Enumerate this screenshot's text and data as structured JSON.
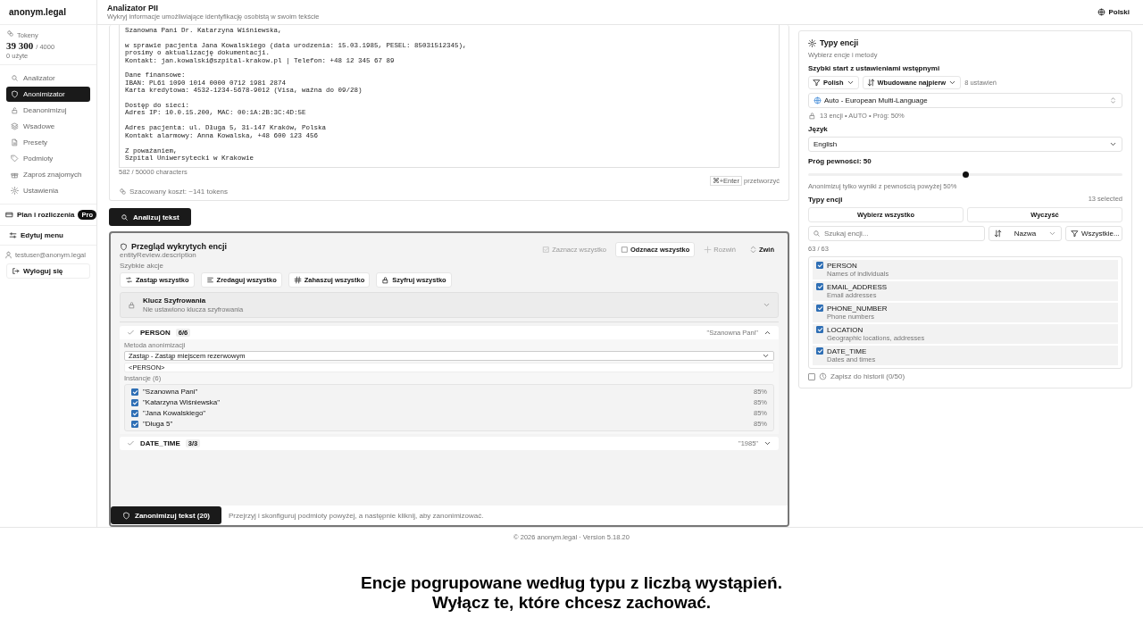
{
  "sidebar": {
    "logo": "anonym.legal",
    "tokens": {
      "label": "Tokeny",
      "value": "39 300",
      "limit": "/ 4000",
      "used": "0 użyte"
    },
    "items": [
      {
        "label": "Analizator",
        "selected": false
      },
      {
        "label": "Anonimizator",
        "selected": true
      },
      {
        "label": "Deanonimizuj",
        "selected": false
      },
      {
        "label": "Wsadowe",
        "selected": false
      },
      {
        "label": "Presety",
        "selected": false
      },
      {
        "label": "Podmioty",
        "selected": false
      },
      {
        "label": "Zaproś znajomych",
        "selected": false
      },
      {
        "label": "Ustawienia",
        "selected": false
      }
    ],
    "plan": {
      "label": "Plan i rozliczenia",
      "badge": "Pro"
    },
    "edit_menu": "Edytuj menu",
    "user": "testuser@anonym.legal",
    "logout": "Wyloguj się"
  },
  "header": {
    "title": "Analizator PII",
    "subtitle": "Wykryj informacje umożliwiające identyfikację osobistą w swoim tekście",
    "language": "Polski"
  },
  "editor": {
    "paragraphs": [
      [
        "Szanowna Pani Dr. Katarzyna Wiśniewska,"
      ],
      [
        "w sprawie pacjenta Jana Kowalskiego (data urodzenia: 15.03.1985, PESEL: 85031512345),",
        "prosimy o aktualizację dokumentacji.",
        "Kontakt: jan.kowalski@szpital-krakow.pl | Telefon: +48 12 345 67 89"
      ],
      [
        "Dane finansowe:",
        "IBAN: PL61 1090 1014 0000 0712 1981 2874",
        "Karta kredytowa: 4532-1234-5678-9012 (Visa, ważna do 09/28)"
      ],
      [
        "Dostęp do sieci:",
        "Adres IP: 10.0.15.200, MAC: 00:1A:2B:3C:4D:5E"
      ],
      [
        "Adres pacjenta: ul. Długa 5, 31-147 Kraków, Polska",
        "Kontakt alarmowy: Anna Kowalska, +48 600 123 456"
      ],
      [
        "Z poważaniem,",
        "Szpital Uniwersytecki w Krakowie"
      ]
    ],
    "char_count": "582 / 50000 characters",
    "shortcut_key": "⌘+Enter",
    "shortcut_label": "przetworzyć",
    "cost": "Szacowany koszt: ~141 tokens"
  },
  "analyze_button": "Analizuj tekst",
  "entity_review": {
    "title": "Przegląd wykrytych encji",
    "description": "entityReview.description",
    "actions": [
      {
        "label": "Zaznacz wszystko",
        "disabled": true
      },
      {
        "label": "Odznacz wszystko",
        "disabled": false
      },
      {
        "label": "Rozwiń",
        "disabled": true
      },
      {
        "label": "Zwiń",
        "disabled": false
      }
    ],
    "quick_label": "Szybkie akcje",
    "quick_actions": [
      "Zastąp wszystko",
      "Zredaguj wszystko",
      "Zahaszuj wszystko",
      "Szyfruj wszystko"
    ],
    "encryption": {
      "title": "Klucz Szyfrowania",
      "status": "Nie ustawiono klucza szyfrowania"
    },
    "groups": [
      {
        "type": "PERSON",
        "count": "6/6",
        "preview": "\"Szanowna Pani\"",
        "expanded": true,
        "method_label": "Metoda anonimizacji",
        "method": "Zastąp - Zastąp miejscem rezerwowym",
        "replacement": "<PERSON>",
        "instances_label": "Instancje (6)",
        "instances": [
          {
            "text": "\"Szanowna Pani\"",
            "score": "85%",
            "checked": true
          },
          {
            "text": "\"Katarzyna Wiśniewska\"",
            "score": "85%",
            "checked": true
          },
          {
            "text": "\"Jana Kowalskiego\"",
            "score": "85%",
            "checked": true
          },
          {
            "text": "\"Długa 5\"",
            "score": "85%",
            "checked": true
          }
        ]
      },
      {
        "type": "DATE_TIME",
        "count": "3/3",
        "preview": "\"1985\"",
        "expanded": false
      }
    ],
    "anonymize_button": "Zanonimizuj tekst (20)",
    "hint": "Przejrzyj i skonfiguruj podmioty powyżej, a następnie kliknij, aby zanonimizować."
  },
  "entity_types": {
    "title": "Typy encji",
    "subtitle": "Wybierz encje i metody",
    "preset_label": "Szybki start z ustawieniami wstępnymi",
    "filter_button": "Polish",
    "sort_button": "Wbudowane najpierw",
    "preset_count": "8 ustawień",
    "preset": "Auto - European Multi-Language",
    "preset_meta": "13 encji • AUTO • Próg: 50%",
    "language_label": "Język",
    "language": "English",
    "threshold": {
      "label": "Próg pewności: 50",
      "level": 0.5,
      "hint": "Anonimizuj tylko wyniki z pewnością powyżej 50%"
    },
    "types_label": "Typy encji",
    "selected_count": "13 selected",
    "select_all": "Wybierz wszystko",
    "clear": "Wyczyść",
    "search_placeholder": "Szukaj encji...",
    "sort": "Nazwa",
    "filter": "Wszystkie...",
    "shown_count": "63 / 63",
    "list": [
      {
        "name": "PERSON",
        "description": "Names of individuals",
        "checked": true
      },
      {
        "name": "EMAIL_ADDRESS",
        "description": "Email addresses",
        "checked": true
      },
      {
        "name": "PHONE_NUMBER",
        "description": "Phone numbers",
        "checked": true
      },
      {
        "name": "LOCATION",
        "description": "Geographic locations, addresses",
        "checked": true
      },
      {
        "name": "DATE_TIME",
        "description": "Dates and times",
        "checked": true
      }
    ],
    "history": {
      "label": "Zapisz do historii (0/50)",
      "checked": false
    }
  },
  "footer": "© 2026 anonym.legal · Version 5.18.20",
  "caption": "Encje pogrupowane według typu z liczbą wystąpień. Wyłącz te, które chcesz zachować."
}
